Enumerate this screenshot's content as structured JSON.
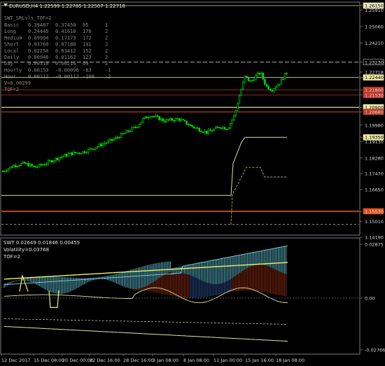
{
  "symbol_header": "EURUSD,H4  1.22599 1.22785 1.22507 1.22718",
  "indicator_main": {
    "title": "SWT_SRLvls_TOF=2",
    "rows": [
      {
        "name": "Basic",
        "a": "0.39487",
        "b": "0.37450",
        "c": "95",
        "d": "1"
      },
      {
        "name": "Long",
        "a": "0.24445",
        "b": "0.41618",
        "c": "170",
        "d": "2"
      },
      {
        "name": "Medium",
        "a": "0.09994",
        "b": "0.17173",
        "c": "172",
        "d": "2"
      },
      {
        "name": "Short",
        "a": "0.03760",
        "b": "0.07180",
        "c": "191",
        "d": "2"
      },
      {
        "name": "Local",
        "a": "0.02250",
        "b": "0.03412",
        "c": "152",
        "d": "2"
      },
      {
        "name": "Daily",
        "a": "0.00946",
        "b": "0.01162",
        "c": "123",
        "d": "2"
      },
      {
        "name": "Day",
        "a": "0.00310",
        "b": "0.00214",
        "c": "69",
        "d": "2"
      },
      {
        "name": "Hourly",
        "a": "0.00153",
        "b": "-0.00096",
        "c": "-63",
        "d": "-1"
      },
      {
        "name": "Hour",
        "a": "0.00112",
        "b": "-0.00112",
        "c": "-100",
        "d": "-2"
      }
    ],
    "v_line": "V=0.00299",
    "tof_line": "TOF=2"
  },
  "price_axis": [
    {
      "label": "1.26150",
      "badge": true,
      "color": "#e8e8c0"
    },
    {
      "label": "1.25910"
    },
    {
      "label": "1.25060"
    },
    {
      "label": "1.24210"
    },
    {
      "label": "1.23230",
      "badge": true,
      "color": "#000000",
      "border": "#c8c8c8"
    },
    {
      "label": "1.22718",
      "badge": true,
      "color": "#000000"
    },
    {
      "label": "1.22440",
      "badge": true,
      "color": "#e8e8a0"
    },
    {
      "label": "1.21800",
      "badge": true,
      "color": "#c0392b"
    },
    {
      "label": "1.21530",
      "badge": true,
      "color": "#c0392b"
    },
    {
      "label": "1.20900",
      "badge": true,
      "color": "#e8e8a0"
    },
    {
      "label": "1.20660",
      "badge": true,
      "color": "#c0392b"
    },
    {
      "label": "1.19980"
    },
    {
      "label": "1.19350",
      "badge": true,
      "color": "#e8e8a0"
    },
    {
      "label": "1.19130"
    },
    {
      "label": "1.18280"
    },
    {
      "label": "1.17470"
    },
    {
      "label": "1.16650"
    },
    {
      "label": "1.15530",
      "badge": true,
      "color": "#e05020"
    },
    {
      "label": "1.15010"
    },
    {
      "label": "1.14190"
    }
  ],
  "indicator_sub": {
    "title": "SWT 0.02649 0.01846 0.00455",
    "volatility": "Volatility=0.03768",
    "tof": "TOF=2",
    "axis": [
      "0.02875",
      "0.00",
      "-0.02766"
    ]
  },
  "time_axis": [
    "12 Dec 2017",
    "15 Dec 08:00",
    "20 Dec 00:00",
    "22 Dec 16:00",
    "28 Dec 16:00",
    "3 Jan 08:00",
    "8 Jan 08:00",
    "11 Jan 00:00",
    "15 Jan 16:00",
    "18 Jan 08:00"
  ],
  "colors": {
    "bull": "#00e000",
    "bear": "#00b000",
    "support": "#e8e8a0",
    "resistance": "#e05020",
    "grid": "#1e3c1e"
  }
}
